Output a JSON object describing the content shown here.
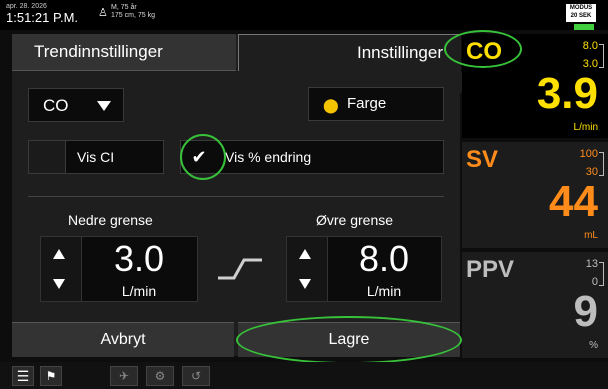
{
  "topbar": {
    "date": "apr. 28. 2026",
    "time": "1:51:21 P.M.",
    "patient_line1": "M, 75 år",
    "patient_line2": "175 cm, 75 kg",
    "modus_label": "MODUS",
    "modus_sub": "20 SEK"
  },
  "tabs": {
    "trend": "Trendinnstillinger",
    "settings": "Innstillinger"
  },
  "settings": {
    "parameter_select": "CO",
    "color_button": "Farge",
    "show_ci_label": "Vis CI",
    "show_ci_checked": false,
    "show_pct_label": "Vis % endring",
    "show_pct_checked": true,
    "lower_label": "Nedre grense",
    "upper_label": "Øvre grense",
    "lower_value": "3.0",
    "upper_value": "8.0",
    "unit": "L/min",
    "cancel": "Avbryt",
    "save": "Lagre"
  },
  "parameters": [
    {
      "name": "CO",
      "max": "8.0",
      "min": "3.0",
      "value": "3.9",
      "unit": "L/min",
      "color": "#ffe000"
    },
    {
      "name": "SV",
      "max": "100",
      "min": "30",
      "value": "44",
      "unit": "mL",
      "color": "#ff8c1a"
    },
    {
      "name": "PPV",
      "max": "13",
      "min": "0",
      "value": "9",
      "unit": "%",
      "color": "#bdbdbd"
    }
  ],
  "colors": {
    "highlight_circle": "#38c23a",
    "check_icon": "#ffffff"
  }
}
